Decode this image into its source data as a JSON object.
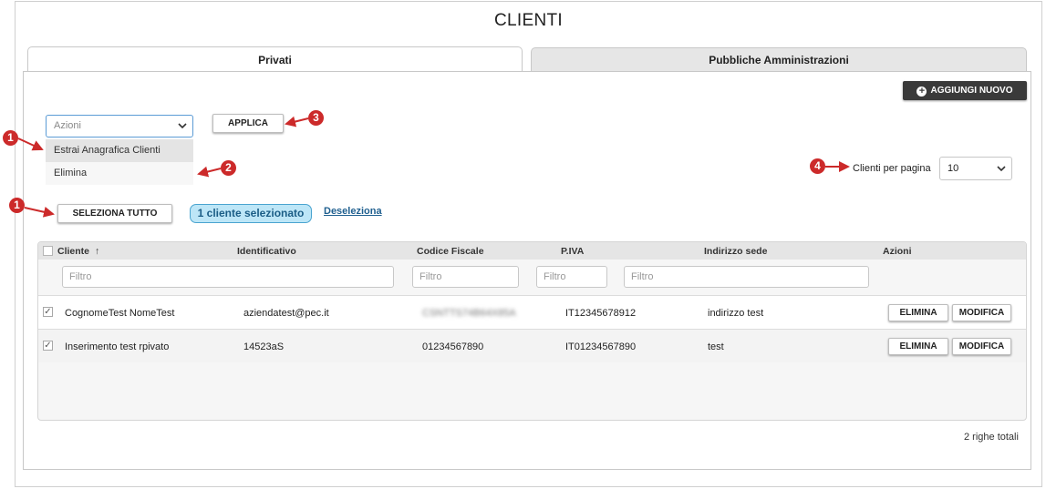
{
  "page_title": "CLIENTI",
  "tabs": [
    {
      "label": "Privati",
      "active": true
    },
    {
      "label": "Pubbliche Amministrazioni",
      "active": false
    }
  ],
  "toolbar": {
    "add_new_label": "AGGIUNGI NUOVO",
    "actions_placeholder": "Azioni",
    "apply_label": "APPLICA",
    "select_all_label": "SELEZIONA TUTTO",
    "selected_badge": "1 cliente selezionato",
    "deselect_link": "Deseleziona",
    "per_page_label": "Clienti per pagina",
    "per_page_value": "10"
  },
  "actions_dropdown": {
    "options": [
      "Estrai Anagrafica Clienti",
      "Elimina"
    ],
    "highlighted": "Estrai Anagrafica Clienti"
  },
  "annotations": {
    "markers": [
      "1",
      "2",
      "3",
      "4",
      "1"
    ],
    "color": "#cc2a2a"
  },
  "table": {
    "columns": [
      "Cliente",
      "Identificativo",
      "Codice Fiscale",
      "P.IVA",
      "Indirizzo sede",
      "Azioni"
    ],
    "sort_icon": "arrow-up-icon",
    "filter_placeholder": "Filtro",
    "rows": [
      {
        "checked": true,
        "cliente": "CognomeTest NomeTest",
        "identificativo": "aziendatest@pec.it",
        "codice_fiscale": "CSNTTS74B64X85A",
        "codice_fiscale_blurred": true,
        "piva": "IT12345678912",
        "indirizzo": "indirizzo test",
        "delete_label": "ELIMINA",
        "edit_label": "MODIFICA"
      },
      {
        "checked": true,
        "cliente": "Inserimento test rpivato",
        "identificativo": "14523aS",
        "codice_fiscale": "01234567890",
        "codice_fiscale_blurred": false,
        "piva": "IT01234567890",
        "indirizzo": "test",
        "delete_label": "ELIMINA",
        "edit_label": "MODIFICA"
      }
    ]
  },
  "footer": {
    "total_rows": "2 righe totali"
  },
  "colors": {
    "accent_dark": "#3a3a3a",
    "badge_bg": "#bde6f7",
    "badge_border": "#4aa4d0",
    "link": "#1f5f8f",
    "focus_border": "#5b9bd5"
  }
}
